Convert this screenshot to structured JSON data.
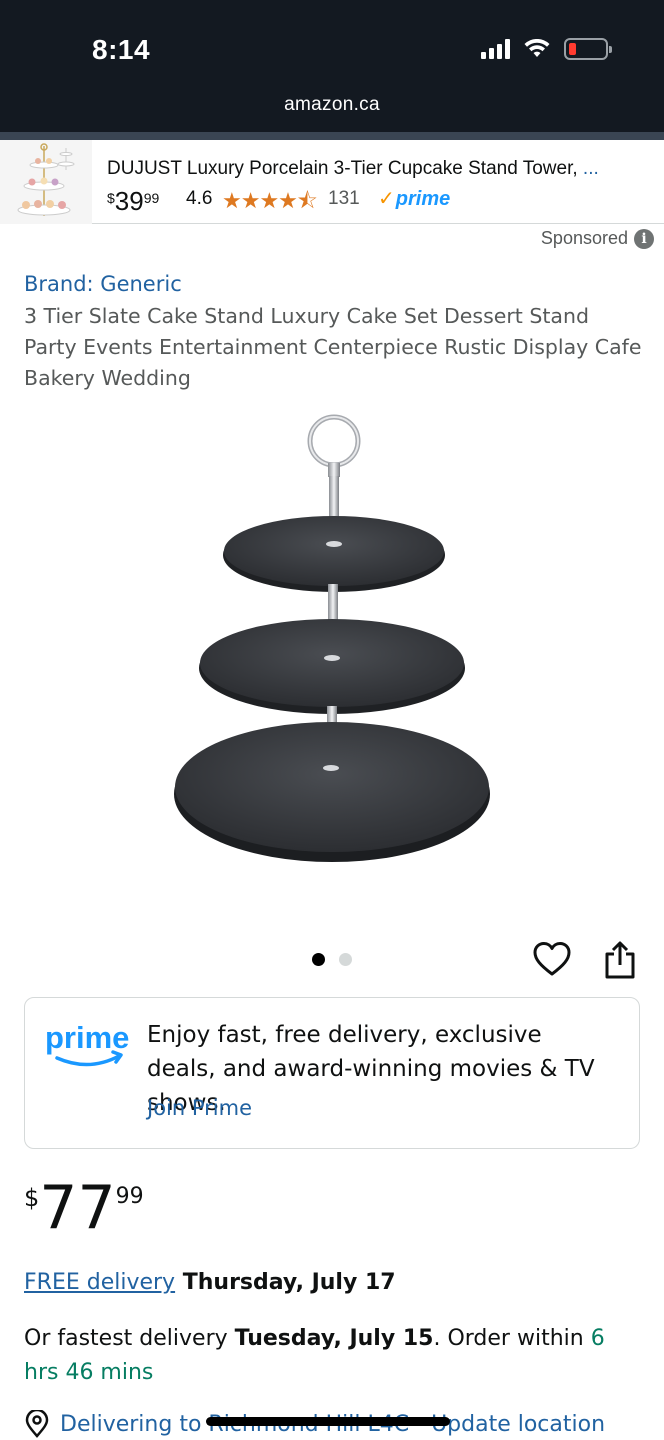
{
  "status_bar": {
    "time": "8:14",
    "battery_color": "#ff3b30"
  },
  "browser": {
    "url": "amazon.ca"
  },
  "sponsored_ad": {
    "title": "DUJUST Luxury Porcelain 3-Tier Cupcake Stand Tower, ",
    "ellipsis": "...",
    "price_symbol": "$",
    "price_whole": "39",
    "price_fraction": "99",
    "rating": "4.6",
    "rating_value": 4.6,
    "stars": "★★★★⯪",
    "review_count": "131",
    "prime_check": "✓",
    "prime_label": "prime",
    "sponsored_label": "Sponsored",
    "info_icon": "i"
  },
  "product": {
    "brand": "Brand: Generic",
    "title": "3 Tier Slate Cake Stand Luxury Cake Set Dessert Stand Party Events Entertainment Centerpiece Rustic Display Cafe Bakery Wedding",
    "image_count": 2,
    "active_image": 0
  },
  "prime_promo": {
    "logo_text": "prime",
    "message": "Enjoy fast, free delivery, exclusive deals, and award-winning movies & TV shows.",
    "cta": "Join Prime"
  },
  "price": {
    "symbol": "$",
    "whole": "77",
    "fraction": "99"
  },
  "delivery": {
    "free_label": "FREE delivery",
    "free_date": " Thursday, July 17",
    "fastest_prefix": "Or fastest delivery ",
    "fastest_date": "Tuesday, July 15",
    "order_within": ". Order within ",
    "countdown": "6 hrs 46 mins"
  },
  "location": {
    "prefix": "Delivering to ",
    "place": "Richmond Hill L4C",
    "separator": " - ",
    "update": "Update location"
  },
  "colors": {
    "link": "#2162a1",
    "star": "#de7921",
    "prime_blue": "#1a98ff",
    "green": "#067d62",
    "header": "#131921"
  }
}
